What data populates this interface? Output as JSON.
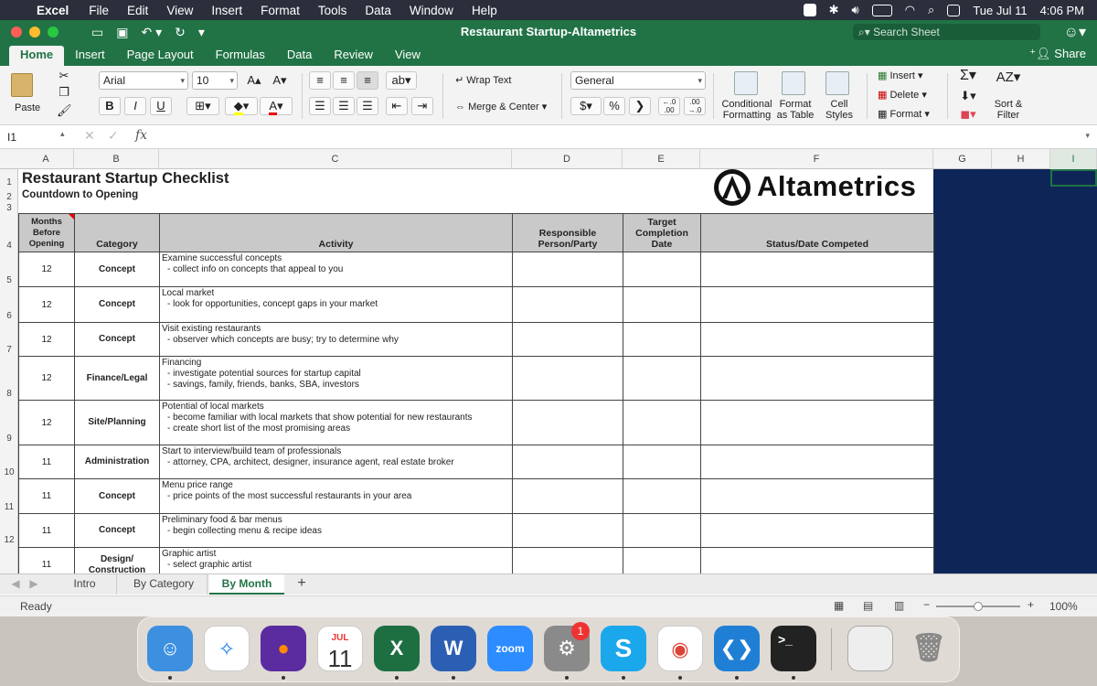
{
  "menubar": {
    "app": "Excel",
    "items": [
      "File",
      "Edit",
      "View",
      "Insert",
      "Format",
      "Tools",
      "Data",
      "Window",
      "Help"
    ],
    "date": "Tue Jul 11",
    "time": "4:06 PM"
  },
  "window": {
    "title": "Restaurant Startup-Altametrics",
    "search_placeholder": "Search Sheet",
    "share_label": "Share"
  },
  "ribbon_tabs": [
    "Home",
    "Insert",
    "Page Layout",
    "Formulas",
    "Data",
    "Review",
    "View"
  ],
  "ribbon": {
    "paste": "Paste",
    "font_name": "Arial",
    "font_size": "10",
    "bold": "B",
    "italic": "I",
    "underline": "U",
    "wrap_text": "Wrap Text",
    "merge_center": "Merge & Center",
    "number_format": "General",
    "currency": "$",
    "percent": "%",
    "comma": "❯",
    "conditional_formatting": [
      "Conditional",
      "Formatting"
    ],
    "format_as_table": [
      "Format",
      "as Table"
    ],
    "cell_styles": [
      "Cell",
      "Styles"
    ],
    "insert": "Insert",
    "delete": "Delete",
    "format": "Format",
    "sort_filter": [
      "Sort &",
      "Filter"
    ]
  },
  "formula_bar": {
    "name_box": "I1",
    "fx": "fx",
    "value": ""
  },
  "columns": [
    "A",
    "B",
    "C",
    "D",
    "E",
    "F",
    "G",
    "H",
    "I"
  ],
  "rows": [
    "1",
    "2",
    "3",
    "4",
    "5",
    "6",
    "7",
    "8",
    "9",
    "10",
    "11",
    "12"
  ],
  "sheet": {
    "title": "Restaurant Startup Checklist",
    "subtitle": "Countdown to Opening",
    "logo_text": "Altametrics",
    "headers": {
      "months": "Months Before Opening",
      "category": "Category",
      "activity": "Activity",
      "responsible": "Responsible Person/Party",
      "target": "Target Completion Date",
      "status": "Status/Date Competed"
    },
    "rows": [
      {
        "month": "12",
        "category": "Concept",
        "title": "Examine successful concepts",
        "details": [
          "- collect info on concepts that appeal to you"
        ]
      },
      {
        "month": "12",
        "category": "Concept",
        "title": "Local market",
        "details": [
          "- look for opportunities, concept gaps in your market"
        ]
      },
      {
        "month": "12",
        "category": "Concept",
        "title": "Visit existing restaurants",
        "details": [
          "- observer which concepts are busy; try to determine why"
        ]
      },
      {
        "month": "12",
        "category": "Finance/Legal",
        "title": "Financing",
        "details": [
          "- investigate potential sources for startup capital",
          "- savings, family, friends, banks, SBA, investors"
        ]
      },
      {
        "month": "12",
        "category": "Site/Planning",
        "title": "Potential of local markets",
        "details": [
          "- become familiar with local markets that show potential for new restaurants",
          "- create short list of the most promising areas"
        ]
      },
      {
        "month": "11",
        "category": "Administration",
        "title": "Start to interview/build team of professionals",
        "details": [
          "- attorney, CPA, architect, designer, insurance agent, real estate broker"
        ]
      },
      {
        "month": "11",
        "category": "Concept",
        "title": "Menu price range",
        "details": [
          "- price points of the most successful restaurants in your area"
        ]
      },
      {
        "month": "11",
        "category": "Concept",
        "title": "Preliminary food & bar menus",
        "details": [
          "- begin collecting menu & recipe ideas"
        ]
      },
      {
        "month": "11",
        "category": "Design/ Construction",
        "title": "Graphic artist",
        "details": [
          "- select graphic artist"
        ]
      }
    ]
  },
  "sheet_tabs": [
    "Intro",
    "By Category",
    "By Month"
  ],
  "add_sheet": "+",
  "status": {
    "ready": "Ready",
    "zoom": "100%",
    "zoom_level": 1.0
  },
  "dock": {
    "calendar_month": "JUL",
    "calendar_day": "11",
    "settings_badge": "1",
    "zoom_label": "zoom"
  },
  "colors": {
    "excel_green": "#217346",
    "navy": "#0e2557",
    "header_gray": "#c9c9c9"
  }
}
